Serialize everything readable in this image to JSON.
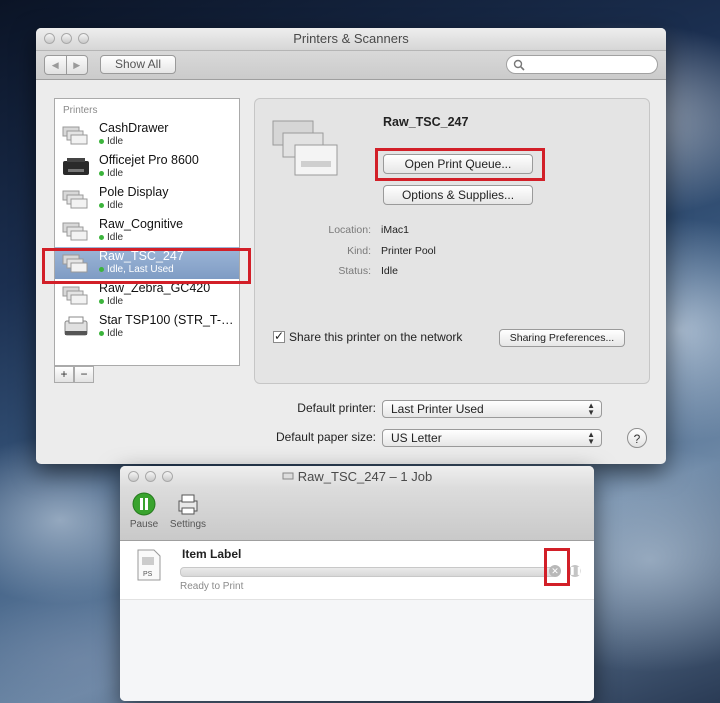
{
  "main_window": {
    "title": "Printers & Scanners",
    "nav_back": "◀",
    "nav_forward": "▶",
    "show_all": "Show All",
    "search_placeholder": ""
  },
  "printers_list": {
    "header": "Printers",
    "items": [
      {
        "name": "CashDrawer",
        "status": "Idle"
      },
      {
        "name": "Officejet Pro 8600",
        "status": "Idle"
      },
      {
        "name": "Pole Display",
        "status": "Idle"
      },
      {
        "name": "Raw_Cognitive",
        "status": "Idle"
      },
      {
        "name": "Raw_TSC_247",
        "status": "Idle, Last Used"
      },
      {
        "name": "Raw_Zebra_GC420",
        "status": "Idle"
      },
      {
        "name": "Star TSP100 (STR_T-…",
        "status": "Idle"
      }
    ],
    "add_label": "+",
    "remove_label": "−"
  },
  "detail": {
    "printer_name": "Raw_TSC_247",
    "open_queue": "Open Print Queue...",
    "options_supplies": "Options & Supplies...",
    "location_label": "Location:",
    "location_value": "iMac1",
    "kind_label": "Kind:",
    "kind_value": "Printer Pool",
    "status_label": "Status:",
    "status_value": "Idle",
    "share_label": "Share this printer on the network",
    "share_checked": true,
    "sharing_prefs": "Sharing Preferences..."
  },
  "defaults": {
    "printer_label": "Default printer:",
    "printer_value": "Last Printer Used",
    "paper_label": "Default paper size:",
    "paper_value": "US Letter",
    "help": "?"
  },
  "queue_window": {
    "title": "Raw_TSC_247 – 1 Job",
    "pause_label": "Pause",
    "settings_label": "Settings",
    "job_name": "Item Label",
    "job_status": "Ready to Print",
    "job_file_type": "PS",
    "progress": 0
  },
  "colors": {
    "highlight_red": "#d21f28",
    "selection_blue": "#7f9cc4",
    "status_green": "#3cb43c",
    "pause_green": "#39a32e"
  }
}
